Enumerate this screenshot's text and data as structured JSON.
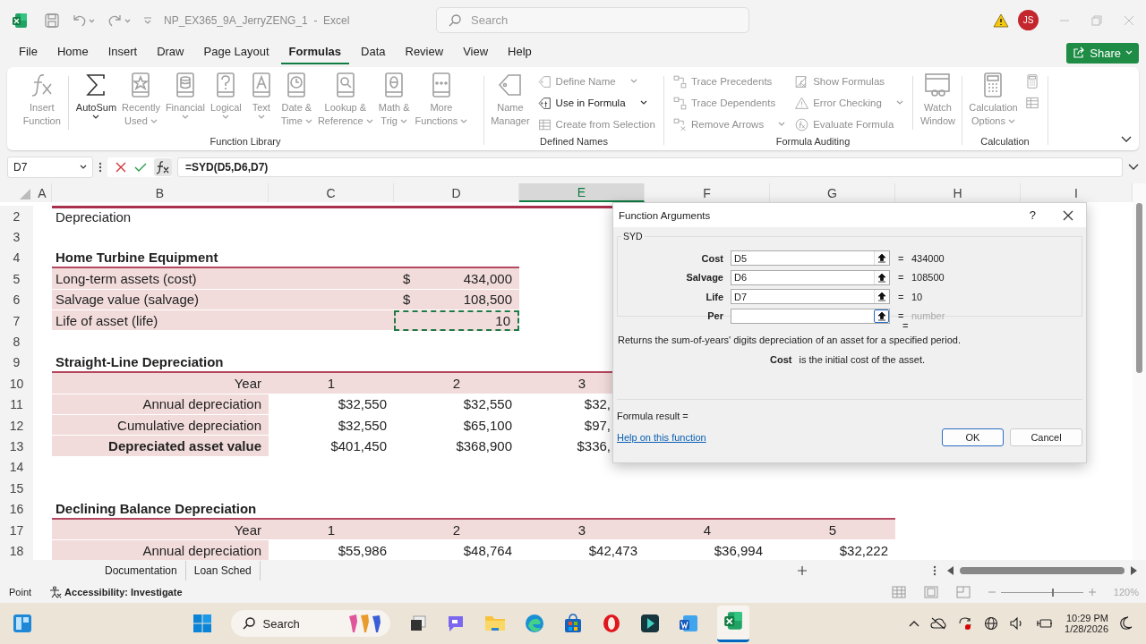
{
  "title_bar": {
    "title": "NP_EX365_9A_JerryZENG_1  -  Excel",
    "search_placeholder": "Search",
    "avatar": "JS"
  },
  "menu": [
    {
      "label": "File",
      "selected": false
    },
    {
      "label": "Home",
      "selected": false
    },
    {
      "label": "Insert",
      "selected": false
    },
    {
      "label": "Draw",
      "selected": false
    },
    {
      "label": "Page Layout",
      "selected": false
    },
    {
      "label": "Formulas",
      "selected": true
    },
    {
      "label": "Data",
      "selected": false
    },
    {
      "label": "Review",
      "selected": false
    },
    {
      "label": "View",
      "selected": false
    },
    {
      "label": "Help",
      "selected": false
    }
  ],
  "share": "Share",
  "ribbon": [
    {
      "label": "Function Library",
      "columns": [
        [
          {
            "kind": "large",
            "lines": [
              "Insert",
              "Function"
            ],
            "disabled": true,
            "dropdown": false
          }
        ],
        [
          {
            "kind": "separator"
          }
        ],
        [
          {
            "kind": "large",
            "lines": [
              "AutoSum"
            ],
            "disabled": false,
            "dropdown": true
          }
        ],
        [
          {
            "kind": "large",
            "lines": [
              "Recently",
              "Used"
            ],
            "disabled": true,
            "dropdown": true
          }
        ],
        [
          {
            "kind": "large",
            "lines": [
              "Financial"
            ],
            "disabled": true,
            "dropdown": true
          }
        ],
        [
          {
            "kind": "large",
            "lines": [
              "Logical"
            ],
            "disabled": true,
            "dropdown": true
          }
        ],
        [
          {
            "kind": "large",
            "lines": [
              "Text"
            ],
            "disabled": true,
            "dropdown": true
          }
        ],
        [
          {
            "kind": "large",
            "lines": [
              "Date &",
              "Time"
            ],
            "disabled": true,
            "dropdown": true
          }
        ],
        [
          {
            "kind": "large",
            "lines": [
              "Lookup &",
              "Reference"
            ],
            "disabled": true,
            "dropdown": true
          }
        ],
        [
          {
            "kind": "large",
            "lines": [
              "Math &",
              "Trig"
            ],
            "disabled": true,
            "dropdown": true
          }
        ],
        [
          {
            "kind": "large",
            "lines": [
              "More",
              "Functions"
            ],
            "disabled": true,
            "dropdown": true
          }
        ]
      ]
    },
    {
      "label": "Defined Names",
      "columns": [
        [
          {
            "kind": "large",
            "lines": [
              "Name",
              "Manager"
            ],
            "disabled": true,
            "dropdown": false
          }
        ],
        [
          {
            "kind": "small",
            "label": "Define Name",
            "disabled": true,
            "dropdown": true
          },
          {
            "kind": "small",
            "label": "Use in Formula",
            "disabled": false,
            "dropdown": true
          },
          {
            "kind": "small",
            "label": "Create from Selection",
            "disabled": true,
            "dropdown": false
          }
        ]
      ]
    },
    {
      "label": "Formula Auditing",
      "columns": [
        [
          {
            "kind": "small",
            "label": "Trace Precedents",
            "disabled": true,
            "dropdown": false
          },
          {
            "kind": "small",
            "label": "Trace Dependents",
            "disabled": true,
            "dropdown": false
          },
          {
            "kind": "small",
            "label": "Remove Arrows",
            "disabled": true,
            "dropdown": true
          }
        ],
        [
          {
            "kind": "small",
            "label": "Show Formulas",
            "disabled": true,
            "dropdown": false
          },
          {
            "kind": "small",
            "label": "Error Checking",
            "disabled": true,
            "dropdown": true
          },
          {
            "kind": "small",
            "label": "Evaluate Formula",
            "disabled": true,
            "dropdown": false
          }
        ],
        [
          {
            "kind": "separator"
          }
        ],
        [
          {
            "kind": "large",
            "lines": [
              "Watch",
              "Window"
            ],
            "disabled": true,
            "dropdown": false
          }
        ]
      ]
    },
    {
      "label": "Calculation",
      "columns": [
        [
          {
            "kind": "large",
            "lines": [
              "Calculation",
              "Options"
            ],
            "disabled": true,
            "dropdown": true
          }
        ],
        [
          {
            "kind": "icon",
            "disabled": true
          },
          {
            "kind": "icon",
            "disabled": true
          }
        ]
      ]
    }
  ],
  "formula_bar": {
    "name_box": "D7",
    "formula": "=SYD(D5,D6,D7)"
  },
  "columns": [
    {
      "label": "A",
      "selected": false
    },
    {
      "label": "B",
      "selected": false
    },
    {
      "label": "C",
      "selected": false
    },
    {
      "label": "D",
      "selected": false
    },
    {
      "label": "E",
      "selected": true
    },
    {
      "label": "F",
      "selected": false
    },
    {
      "label": "G",
      "selected": false
    },
    {
      "label": "H",
      "selected": false
    },
    {
      "label": "I",
      "selected": false
    }
  ],
  "rows": [
    {
      "num": "2",
      "kind": "title",
      "B": {
        "text": "Depreciation"
      }
    },
    {
      "num": "3",
      "kind": "blank"
    },
    {
      "num": "4",
      "kind": "heading",
      "B": {
        "text": "Home Turbine Equipment"
      }
    },
    {
      "num": "5",
      "kind": "item",
      "B": {
        "text": "Long-term assets (cost)"
      },
      "D": {
        "text": "434,000",
        "currency": "$"
      }
    },
    {
      "num": "6",
      "kind": "item",
      "B": {
        "text": "Salvage value (salvage)"
      },
      "D": {
        "text": "108,500",
        "currency": "$"
      }
    },
    {
      "num": "7",
      "kind": "item",
      "B": {
        "text": "Life of asset (life)"
      },
      "D": {
        "text": "10",
        "marquee": true
      }
    },
    {
      "num": "8",
      "kind": "blank"
    },
    {
      "num": "9",
      "kind": "heading",
      "B": {
        "text": "Straight-Line Depreciation"
      }
    },
    {
      "num": "10",
      "kind": "years",
      "B": {
        "text": "Year"
      },
      "C": {
        "text": "1"
      },
      "D": {
        "text": "2"
      },
      "E": {
        "text": "3"
      }
    },
    {
      "num": "11",
      "kind": "data",
      "B": {
        "text": "Annual depreciation"
      },
      "C": {
        "text": "$32,550"
      },
      "D": {
        "text": "$32,550"
      },
      "E": {
        "text": "$32,",
        "cut": true
      }
    },
    {
      "num": "12",
      "kind": "data",
      "B": {
        "text": "Cumulative depreciation"
      },
      "C": {
        "text": "$32,550"
      },
      "D": {
        "text": "$65,100"
      },
      "E": {
        "text": "$97,",
        "cut": true
      }
    },
    {
      "num": "13",
      "kind": "total",
      "B": {
        "text": "Depreciated asset value"
      },
      "C": {
        "text": "$401,450"
      },
      "D": {
        "text": "$368,900"
      },
      "E": {
        "text": "$336,",
        "cut": true
      }
    },
    {
      "num": "14",
      "kind": "blank"
    },
    {
      "num": "15",
      "kind": "blank"
    },
    {
      "num": "16",
      "kind": "heading",
      "B": {
        "text": "Declining Balance Depreciation"
      }
    },
    {
      "num": "17",
      "kind": "years",
      "B": {
        "text": "Year"
      },
      "C": {
        "text": "1"
      },
      "D": {
        "text": "2"
      },
      "E": {
        "text": "3"
      },
      "F": {
        "text": "4"
      },
      "G": {
        "text": "5"
      }
    },
    {
      "num": "18",
      "kind": "data",
      "B": {
        "text": "Annual depreciation"
      },
      "C": {
        "text": "$55,986"
      },
      "D": {
        "text": "$48,764"
      },
      "E": {
        "text": "$42,473"
      },
      "F": {
        "text": "$36,994"
      },
      "G": {
        "text": "$32,222"
      }
    }
  ],
  "dialog": {
    "title": "Function Arguments",
    "help": "?",
    "function": "SYD",
    "args": [
      {
        "label": "Cost",
        "value": "D5",
        "result": "434000",
        "hint": false,
        "focused": false
      },
      {
        "label": "Salvage",
        "value": "D6",
        "result": "108500",
        "hint": false,
        "focused": false
      },
      {
        "label": "Life",
        "value": "D7",
        "result": "10",
        "hint": false,
        "focused": false
      },
      {
        "label": "Per",
        "result": "number",
        "hint": true,
        "focused": true
      }
    ],
    "equals": "=",
    "description": "Returns the sum-of-years' digits depreciation of an asset for a specified period.",
    "arg_name": "Cost",
    "arg_help": "is the initial cost of the asset.",
    "formula_result": "Formula result =",
    "help_link": "Help on this function",
    "buttons": [
      {
        "label": "OK",
        "default": true
      },
      {
        "label": "Cancel",
        "default": false
      }
    ]
  },
  "sheet_tabs": [
    {
      "label": "Documentation",
      "selected": false
    },
    {
      "label": "Loan Sched",
      "selected": false
    }
  ],
  "status": {
    "mode": "Point",
    "accessibility": "Accessibility: Investigate",
    "zoom": {
      "label": "120%",
      "level": 0.62
    }
  },
  "taskbar": {
    "search": "Search",
    "time": "10:29 PM",
    "date": "1/28/2026"
  }
}
